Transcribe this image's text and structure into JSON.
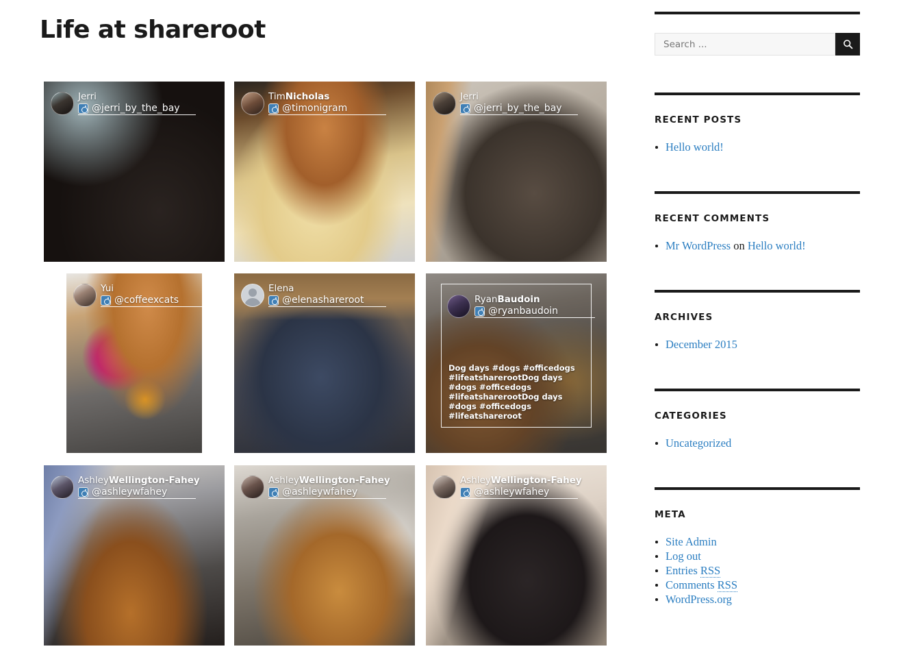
{
  "site": {
    "title": "Life at shareroot"
  },
  "colors": {
    "link": "#2b7ec1",
    "rule": "#1a1a1a",
    "text": "#1a1a1a",
    "search_button_bg": "#1a1a1a",
    "search_field_bg": "#f7f7f7"
  },
  "grid": {
    "tiles": [
      {
        "name_first": "Jerri",
        "name_last": "",
        "handle": "@jerri_by_the_bay",
        "network_icon": "instagram-icon",
        "caption": "",
        "avatar_kind": "photo",
        "highlighted": false
      },
      {
        "name_first": "Tim",
        "name_last": "Nicholas",
        "handle": "@timonigram",
        "network_icon": "instagram-icon",
        "caption": "",
        "avatar_kind": "photo",
        "highlighted": false
      },
      {
        "name_first": "Jerri",
        "name_last": "",
        "handle": "@jerri_by_the_bay",
        "network_icon": "instagram-icon",
        "caption": "",
        "avatar_kind": "photo",
        "highlighted": false
      },
      {
        "name_first": "Yui",
        "name_last": "",
        "handle": "@coffeexcats",
        "network_icon": "instagram-icon",
        "caption": "",
        "avatar_kind": "photo",
        "highlighted": false
      },
      {
        "name_first": "Elena",
        "name_last": "",
        "handle": "@elenashareroot",
        "network_icon": "instagram-icon",
        "caption": "",
        "avatar_kind": "placeholder",
        "highlighted": false
      },
      {
        "name_first": "Ryan",
        "name_last": "Baudoin",
        "handle": "@ryanbaudoin",
        "network_icon": "instagram-icon",
        "caption": "Dog days #dogs #officedogs #lifeatsharerootDog days #dogs #officedogs #lifeatsharerootDog days #dogs #officedogs #lifeatshareroot",
        "avatar_kind": "photo",
        "highlighted": true
      },
      {
        "name_first": "Ashley",
        "name_last": "Wellington-Fahey",
        "handle": "@ashleywfahey",
        "network_icon": "instagram-icon",
        "caption": "",
        "avatar_kind": "photo",
        "highlighted": false
      },
      {
        "name_first": "Ashley",
        "name_last": "Wellington-Fahey",
        "handle": "@ashleywfahey",
        "network_icon": "instagram-icon",
        "caption": "",
        "avatar_kind": "photo",
        "highlighted": false
      },
      {
        "name_first": "Ashley",
        "name_last": "Wellington-Fahey",
        "handle": "@ashleywfahey",
        "network_icon": "instagram-icon",
        "caption": "",
        "avatar_kind": "photo",
        "highlighted": false
      }
    ]
  },
  "sidebar": {
    "search": {
      "placeholder": "Search ...",
      "value": "",
      "button_icon": "search-icon"
    },
    "widgets": [
      {
        "title": "Recent Posts",
        "items": [
          {
            "link": "Hello world!"
          }
        ]
      },
      {
        "title": "Recent Comments",
        "items": [
          {
            "link": "Mr WordPress",
            "middle": " on ",
            "link2": "Hello world!"
          }
        ]
      },
      {
        "title": "Archives",
        "items": [
          {
            "link": "December 2015"
          }
        ]
      },
      {
        "title": "Categories",
        "items": [
          {
            "link": "Uncategorized"
          }
        ]
      },
      {
        "title": "Meta",
        "items": [
          {
            "link": "Site Admin"
          },
          {
            "link": "Log out"
          },
          {
            "link": "Entries ",
            "abbr": "RSS"
          },
          {
            "link": "Comments ",
            "abbr": "RSS"
          },
          {
            "link": "WordPress.org"
          }
        ]
      }
    ]
  }
}
